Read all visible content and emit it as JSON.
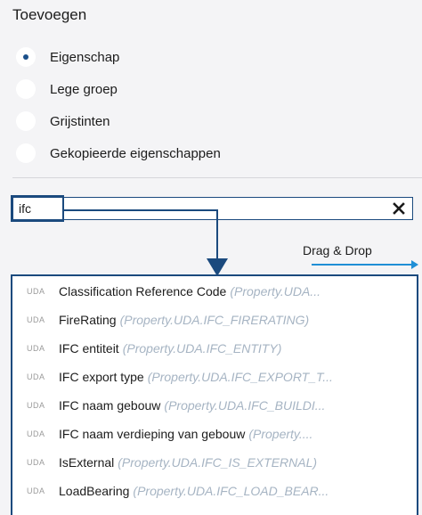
{
  "section": {
    "title": "Toevoegen"
  },
  "radio_options": [
    {
      "label": "Eigenschap",
      "checked": true
    },
    {
      "label": "Lege groep",
      "checked": false
    },
    {
      "label": "Grijstinten",
      "checked": false
    },
    {
      "label": "Gekopieerde eigenschappen",
      "checked": false
    }
  ],
  "search": {
    "value": "ifc",
    "clear_icon": "close-icon"
  },
  "drag_drop": {
    "label": "Drag & Drop"
  },
  "colors": {
    "accent": "#1b4a7e",
    "drag_arrow": "#1f8fd6",
    "muted_property": "#a6b4c3",
    "uda_tag": "#9a9a9a"
  },
  "properties": [
    {
      "tag": "UDA",
      "name": "Classification Reference Code",
      "property": "(Property.UDA..."
    },
    {
      "tag": "UDA",
      "name": "FireRating",
      "property": "(Property.UDA.IFC_FIRERATING)"
    },
    {
      "tag": "UDA",
      "name": "IFC entiteit",
      "property": "(Property.UDA.IFC_ENTITY)"
    },
    {
      "tag": "UDA",
      "name": "IFC export type",
      "property": "(Property.UDA.IFC_EXPORT_T..."
    },
    {
      "tag": "UDA",
      "name": "IFC naam gebouw",
      "property": "(Property.UDA.IFC_BUILDI..."
    },
    {
      "tag": "UDA",
      "name": "IFC naam verdieping van gebouw",
      "property": "(Property...."
    },
    {
      "tag": "UDA",
      "name": "IsExternal",
      "property": "(Property.UDA.IFC_IS_EXTERNAL)"
    },
    {
      "tag": "UDA",
      "name": "LoadBearing",
      "property": "(Property.UDA.IFC_LOAD_BEAR..."
    }
  ]
}
